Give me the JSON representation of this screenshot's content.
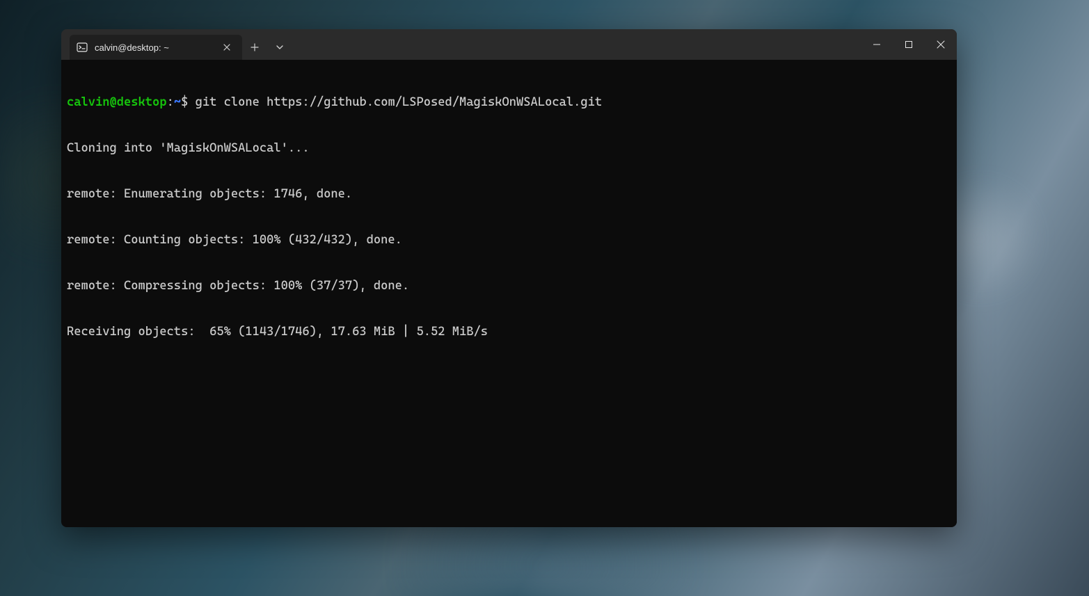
{
  "titlebar": {
    "tab_title": "calvin@desktop: ~"
  },
  "prompt": {
    "user_host": "calvin@desktop",
    "colon": ":",
    "path": "~",
    "symbol": "$",
    "command": "git clone https://github.com/LSPosed/MagiskOnWSALocal.git"
  },
  "output": {
    "line1": "Cloning into 'MagiskOnWSALocal'...",
    "line2": "remote: Enumerating objects: 1746, done.",
    "line3": "remote: Counting objects: 100% (432/432), done.",
    "line4": "remote: Compressing objects: 100% (37/37), done.",
    "line5": "Receiving objects:  65% (1143/1746), 17.63 MiB | 5.52 MiB/s"
  }
}
